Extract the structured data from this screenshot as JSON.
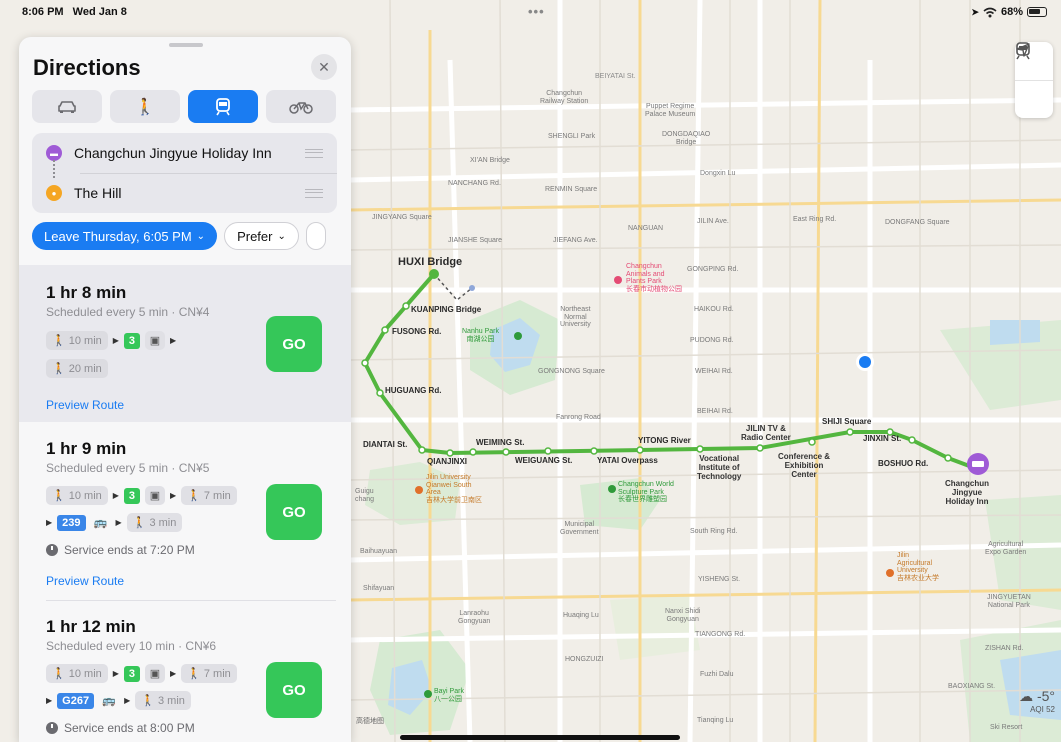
{
  "status": {
    "time": "8:06 PM",
    "date": "Wed Jan 8",
    "battery": "68%"
  },
  "panel": {
    "title": "Directions",
    "modes": [
      "car",
      "walk",
      "transit",
      "bike"
    ],
    "active_mode": "transit",
    "origin": "Changchun Jingyue Holiday Inn",
    "destination": "The Hill",
    "leave_chip": "Leave Thursday, 6:05 PM",
    "prefer_chip": "Prefer"
  },
  "routes": [
    {
      "duration": "1 hr 8 min",
      "schedule": "Scheduled every 5 min · CN¥4",
      "walk1": "10 min",
      "line": "3",
      "walk_last": "20 min",
      "preview": "Preview Route",
      "go": "GO"
    },
    {
      "duration": "1 hr 9 min",
      "schedule": "Scheduled every 5 min · CN¥5",
      "walk1": "10 min",
      "line": "3",
      "walk2": "7 min",
      "bus": "239",
      "walk3": "3 min",
      "service": "Service ends at 7:20 PM",
      "preview": "Preview Route",
      "go": "GO"
    },
    {
      "duration": "1 hr 12 min",
      "schedule": "Scheduled every 10 min · CN¥6",
      "walk1": "10 min",
      "line": "3",
      "walk2": "7 min",
      "bus": "G267",
      "walk3": "3 min",
      "service": "Service ends at 8:00 PM",
      "go": "GO"
    }
  ],
  "map": {
    "weather_temp": "-5°",
    "aqi": "AQI 52",
    "logo": "高德地图",
    "stations": {
      "huxi": "HUXI Bridge",
      "kuanping": "KUANPING Bridge",
      "fusong": "FUSONG Rd.",
      "huguang": "HUGUANG Rd.",
      "diantai": "DIANTAI St.",
      "qianjinxi": "QIANJINXI",
      "weiming": "WEIMING St.",
      "weiguang": "WEIGUANG St.",
      "yatai": "YATAI Overpass",
      "yitong": "YITONG River",
      "vocational": "Vocational\nInstitute of\nTechnology",
      "jilintv": "JILIN TV &\nRadio Center",
      "conference": "Conference &\nExhibition\nCenter",
      "shiji": "SHIJI Square",
      "jinxin": "JINXIN St.",
      "boshuo": "BOSHUO Rd.",
      "destination_label": "Changchun\nJingyue\nHoliday Inn"
    },
    "labels": {
      "beiyatai": "BEIYATAI St.",
      "railway": "Changchun\nRailway Station",
      "puppet": "Puppet Regime\nPalace Museum",
      "shengli": "SHENGLI Park",
      "dongdaqiao": "DONGDAQIAO\nBridge",
      "xian": "XI'AN Bridge",
      "nanchang": "NANCHANG Rd.",
      "renmin": "RENMIN Square",
      "dongxin": "Dongxin Lu",
      "jingyang": "JINGYANG Square",
      "nanguan": "NANGUAN",
      "jilinave": "JILIN Ave.",
      "eastring": "East Ring Rd.",
      "dongfang": "DONGFANG Square",
      "jianshe": "JIANSHE Square",
      "jiefang": "JIEFANG Ave.",
      "zoo": "Changchun\nAnimals and\nPlants Park\n长春市动植物公园",
      "gongping": "GONGPING Rd.",
      "nenu": "Northeast\nNormal\nUniversity",
      "haikou": "HAIKOU Rd.",
      "nanhu": "Nanhu Park\n南湖公园",
      "pudong": "PUDONG Rd.",
      "gongnong": "GONGNONG Square",
      "weihai": "WEIHAI Rd.",
      "fanrong": "Fanrong Road",
      "beihai": "BEIHAI Rd.",
      "jilinu": "Jilin University\nQianwei South\nArea\n吉林大学前卫南区",
      "sculpture": "Changchun World\nSculpture Park\n长春世界雕塑园",
      "municipal": "Municipal\nGovernment",
      "southring": "South Ring Rd.",
      "agri": "Agricultural\nExpo Garden",
      "jilinagri": "Jilin\nAgricultural\nUniversity\n吉林农业大学",
      "yisheng": "YISHENG St.",
      "jingyuetan": "JINGYUETAN\nNational Park",
      "lanraohu": "Lanraohu\nGongyuan",
      "huaqing": "Huaqing Lu",
      "nanxi": "Nanxi Shidi\nGongyuan",
      "tiangong": "TIANGONG Rd.",
      "zishan": "ZISHAN Rd.",
      "hongzuizi": "HONGZUIZI",
      "fuzhi": "Fuzhi Dalu",
      "baoxiang": "BAOXIANG St.",
      "bayi": "Bayi Park\n八一公园",
      "tianqing": "Tianqing Lu",
      "ski": "Ski Resort",
      "qianjin": "QIANJIN Rd.",
      "guigu": "Guigu\nchang",
      "baihuayuan": "Baihuayuan",
      "shifayuan": "Shifayuan"
    }
  }
}
